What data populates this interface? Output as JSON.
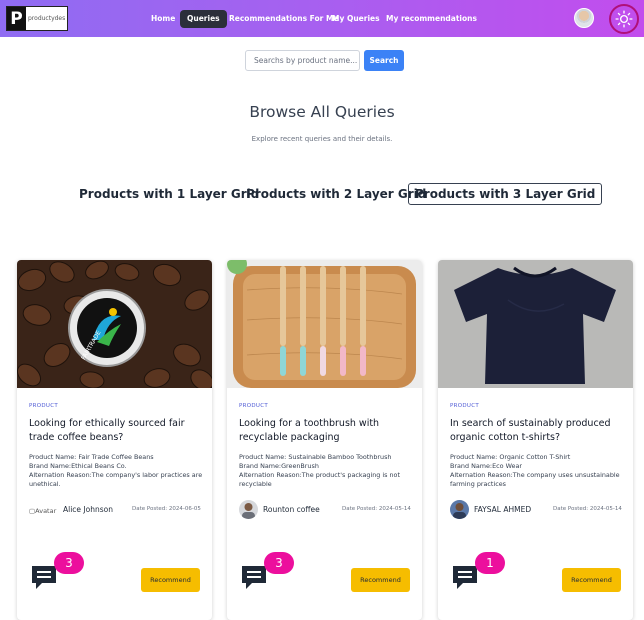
{
  "nav": {
    "logo_text": "productydes",
    "logo_letter": "P",
    "links": [
      "Home",
      "Queries",
      "Recommendations For Me",
      "My Queries",
      "My recommendations"
    ],
    "active_link": "Queries"
  },
  "search": {
    "placeholder": "Searchs by product name...",
    "button_label": "Search"
  },
  "page": {
    "title": "Browse All Queries",
    "subtitle": "Explore recent queries and their details."
  },
  "grid_tabs": [
    "Products with 1 Layer Grid",
    "Products with 2 Layer Grid",
    "Products with 3 Layer Grid"
  ],
  "active_grid_tab": "Products with 3 Layer Grid",
  "cards": [
    {
      "category": "PRODUCT",
      "title": "Looking for ethically sourced fair trade coffee beans?",
      "product_name": "Product Name: Fair Trade Coffee Beans",
      "brand_name": "Brand Name:Ethical Beans Co.",
      "alternation_reason": "Alternation Reason:The company's labor practices are unethical.",
      "author_avatar_alt": "Avatar",
      "author_name": "Alice Johnson",
      "date_posted": "Date Posted: 2024-06-05",
      "comment_count": "3",
      "recommend_label": "Recommend",
      "image_icon": "coffee-beans-fairtrade-photo",
      "image_label": "FAIRTRADE"
    },
    {
      "category": "PRODUCT",
      "title": "Looking for a toothbrush with recyclable packaging",
      "product_name": "Product Name: Sustainable Bamboo Toothbrush",
      "brand_name": "Brand Name:GreenBrush",
      "alternation_reason": "Alternation Reason:The product's packaging is not recyclable",
      "author_avatar_alt": "",
      "author_name": "Rounton coffee",
      "date_posted": "Date Posted: 2024-05-14",
      "comment_count": "3",
      "recommend_label": "Recommend",
      "image_icon": "bamboo-toothbrushes-photo"
    },
    {
      "category": "PRODUCT",
      "title": "In search of sustainably produced organic cotton t-shirts?",
      "product_name": "Product Name: Organic Cotton T-Shirt",
      "brand_name": "Brand Name:Eco Wear",
      "alternation_reason": "Alternation Reason:The company uses unsustainable farming practices",
      "author_avatar_alt": "",
      "author_name": "FAYSAL AHMED",
      "date_posted": "Date Posted: 2024-05-14",
      "comment_count": "1",
      "recommend_label": "Recommend",
      "image_icon": "navy-tshirt-photo"
    }
  ],
  "colors": {
    "nav_gradient_start": "#8f6cf2",
    "nav_gradient_end": "#c24ded",
    "search_button": "#3b82f6",
    "badge": "#ec0f9d",
    "recommend_button": "#f6bd00",
    "category_text": "#4f5bd5"
  },
  "icons": {
    "theme_toggle": "sun-icon",
    "comment": "comment-icon"
  }
}
